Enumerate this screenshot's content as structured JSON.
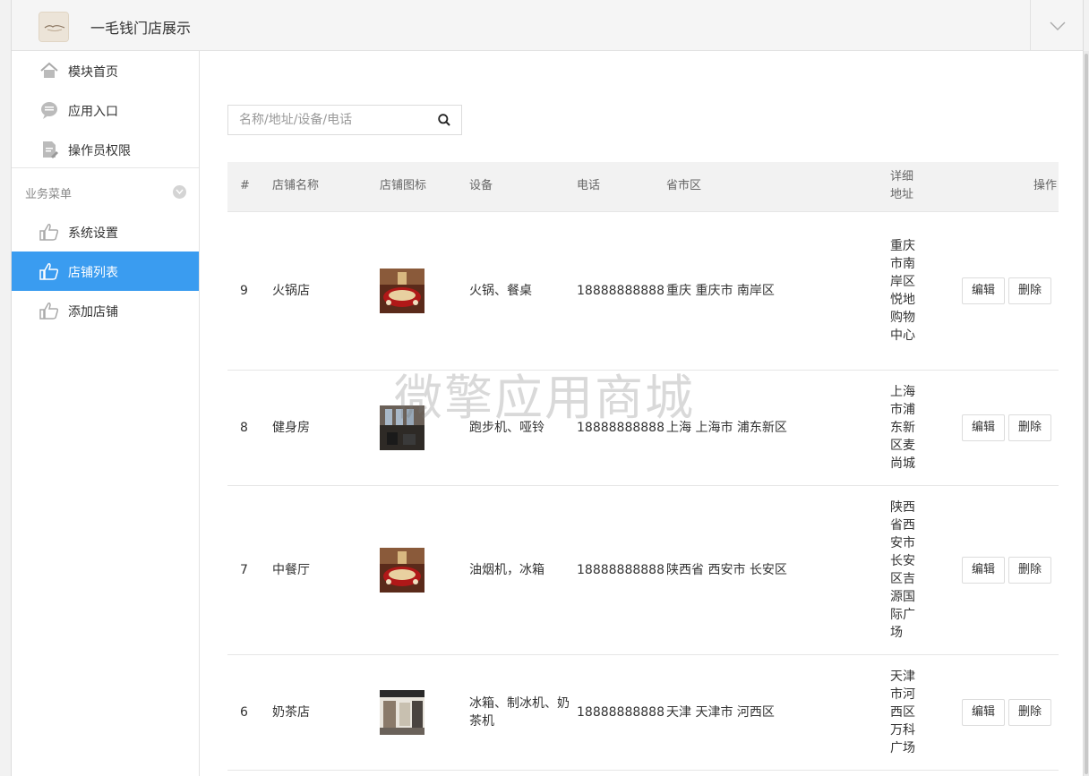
{
  "app": {
    "title": "一毛钱门店展示"
  },
  "sidebar": {
    "items": [
      {
        "label": "模块首页",
        "icon": "home-icon"
      },
      {
        "label": "应用入口",
        "icon": "chat-bubble-icon"
      },
      {
        "label": "操作员权限",
        "icon": "document-edit-icon"
      }
    ],
    "group_title": "业务菜单",
    "business_items": [
      {
        "label": "系统设置",
        "icon": "thumbs-up-icon"
      },
      {
        "label": "店铺列表",
        "icon": "thumbs-up-icon",
        "active": true
      },
      {
        "label": "添加店铺",
        "icon": "thumbs-up-icon"
      }
    ]
  },
  "search": {
    "placeholder": "名称/地址/设备/电话"
  },
  "table": {
    "headers": {
      "id": "#",
      "name": "店铺名称",
      "icon": "店铺图标",
      "devices": "设备",
      "phone": "电话",
      "region": "省市区",
      "address": "详细地址",
      "actions": "操作"
    },
    "edit_label": "编辑",
    "delete_label": "删除",
    "rows": [
      {
        "id": "9",
        "name": "火锅店",
        "devices": "火锅、餐桌",
        "phone": "18888888888",
        "region": "重庆 重庆市 南岸区",
        "address": "重庆市南岸区悦地购物中心"
      },
      {
        "id": "8",
        "name": "健身房",
        "devices": "跑步机、哑铃",
        "phone": "18888888888",
        "region": "上海 上海市 浦东新区",
        "address": "上海市浦东新区麦尚城"
      },
      {
        "id": "7",
        "name": "中餐厅",
        "devices": "油烟机，冰箱",
        "phone": "18888888888",
        "region": "陕西省 西安市 长安区",
        "address": "陕西省西安市长安区吉源国际广场"
      },
      {
        "id": "6",
        "name": "奶茶店",
        "devices": "冰箱、制冰机、奶茶机",
        "phone": "18888888888",
        "region": "天津 天津市 河西区",
        "address": "天津市河西区万科广场"
      }
    ]
  },
  "watermark": "微擎应用商城",
  "colors": {
    "accent": "#3a9cf0",
    "sidebar_bg": "#ffffff",
    "topbar_bg": "#f5f5f5"
  }
}
